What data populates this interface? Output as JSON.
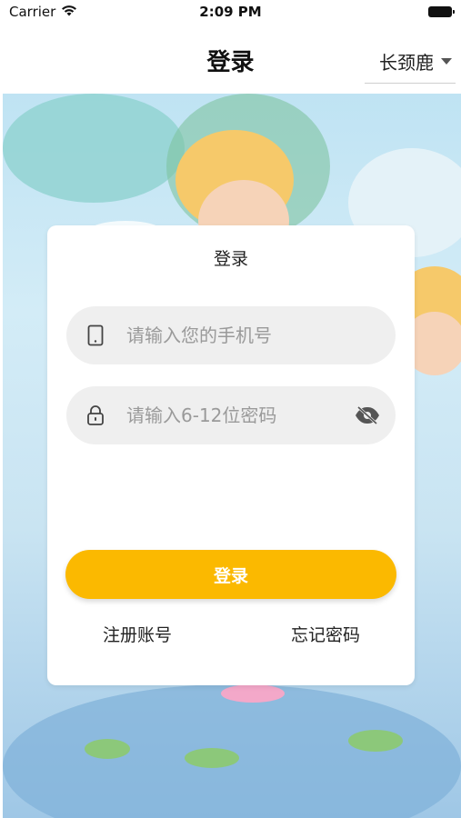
{
  "status_bar": {
    "carrier": "Carrier",
    "time": "2:09 PM",
    "wifi_icon": "wifi-icon",
    "battery_icon": "battery-icon"
  },
  "nav": {
    "title": "登录",
    "language": "长颈鹿"
  },
  "card": {
    "title": "登录",
    "phone_placeholder": "请输入您的手机号",
    "password_placeholder": "请输入6-12位密码",
    "login_button": "登录",
    "register_link": "注册账号",
    "forgot_link": "忘记密码"
  },
  "colors": {
    "accent": "#fbb900",
    "field_bg": "#efefef"
  }
}
